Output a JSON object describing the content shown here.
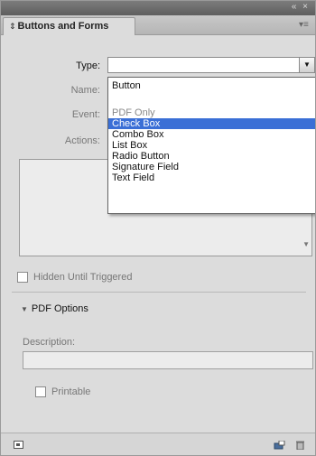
{
  "panel": {
    "tab_label": "Buttons and Forms",
    "window_controls": "« ×"
  },
  "form": {
    "type_label": "Type:",
    "type_value": "",
    "name_label": "Name:",
    "event_label": "Event:",
    "actions_label": "Actions:"
  },
  "dropdown": {
    "items": [
      {
        "label": "Button",
        "state": "normal"
      },
      {
        "label": "PDF Only",
        "state": "disabled"
      },
      {
        "label": "Check Box",
        "state": "selected"
      },
      {
        "label": "Combo Box",
        "state": "normal"
      },
      {
        "label": "List Box",
        "state": "normal"
      },
      {
        "label": "Radio Button",
        "state": "normal"
      },
      {
        "label": "Signature Field",
        "state": "normal"
      },
      {
        "label": "Text Field",
        "state": "normal"
      }
    ]
  },
  "hidden_until_triggered": {
    "label": "Hidden Until Triggered",
    "checked": false
  },
  "pdf_options": {
    "title": "PDF Options",
    "description_label": "Description:",
    "description_value": "",
    "printable_label": "Printable",
    "printable_checked": false
  },
  "icons": [
    "collapse-icon",
    "panel-menu-icon",
    "dropdown-arrow-icon",
    "preview-icon",
    "new-button-icon",
    "trash-icon"
  ],
  "colors": {
    "selection": "#3a6fd6",
    "panel_bg": "#dcdcdc"
  }
}
